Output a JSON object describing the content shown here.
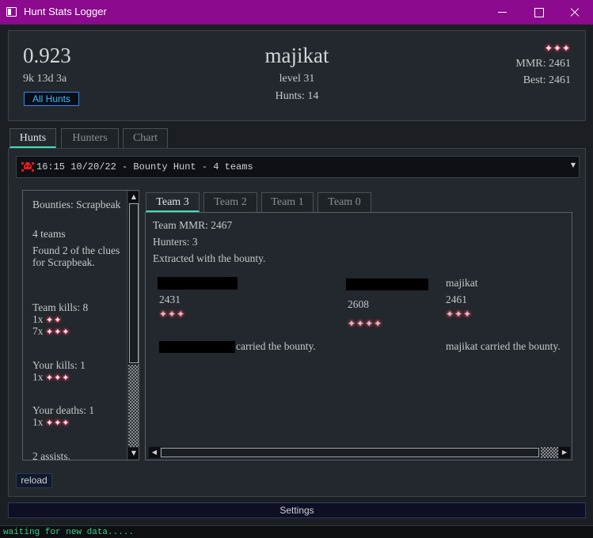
{
  "window": {
    "title": "Hunt Stats Logger"
  },
  "header": {
    "kd": "0.923",
    "kda": "9k 13d 3a",
    "all_hunts_label": "All Hunts",
    "player_name": "majikat",
    "level": "level 31",
    "hunts": "Hunts: 14",
    "stars": "✦✦✦",
    "mmr": "MMR: 2461",
    "best": "Best: 2461"
  },
  "tabs": [
    {
      "label": "Hunts",
      "active": true
    },
    {
      "label": "Hunters",
      "active": false
    },
    {
      "label": "Chart",
      "active": false
    }
  ],
  "hunt_select": {
    "value": "16:15 10/20/22 - Bounty Hunt - 4 teams",
    "icon": "skull-icon"
  },
  "info": {
    "bounties": "Bounties: Scrapbeak",
    "teams": "4 teams",
    "clues": "Found 2 of the clues for Scrapbeak.",
    "team_kills": "Team kills: 8",
    "tk1_count": "1x",
    "tk1_stars": "✦✦",
    "tk2_count": "7x",
    "tk2_stars": "✦✦✦",
    "your_kills": "Your kills: 1",
    "yk_count": "1x",
    "yk_stars": "✦✦✦",
    "your_deaths": "Your deaths: 1",
    "yd_count": "1x",
    "yd_stars": "✦✦✦",
    "assists": "2 assists."
  },
  "team_tabs": [
    {
      "label": "Team 3",
      "active": true
    },
    {
      "label": "Team 2",
      "active": false
    },
    {
      "label": "Team 1",
      "active": false
    },
    {
      "label": "Team 0",
      "active": false
    }
  ],
  "team": {
    "mmr": "Team MMR: 2467",
    "hunters": "Hunters: 3",
    "extracted": "Extracted with the bounty.",
    "members": [
      {
        "name": "",
        "mmr": "2431",
        "stars": "✦✦✦",
        "redacted": true
      },
      {
        "name": "",
        "mmr": "2608",
        "stars": "✦✦✦✦",
        "redacted": true
      },
      {
        "name": "majikat",
        "mmr": "2461",
        "stars": "✦✦✦",
        "redacted": false
      }
    ],
    "carried_1": "carried the bounty.",
    "carried_2": "majikat carried the bounty."
  },
  "reload_label": "reload",
  "settings_label": "Settings",
  "status": "waiting for new data.....",
  "colors": {
    "titlebar": "#8b0a8d",
    "accent": "#3ce0b8",
    "link": "#3cb8ff",
    "status": "#3ccf8e",
    "star_glow": "#ff2a4d"
  }
}
